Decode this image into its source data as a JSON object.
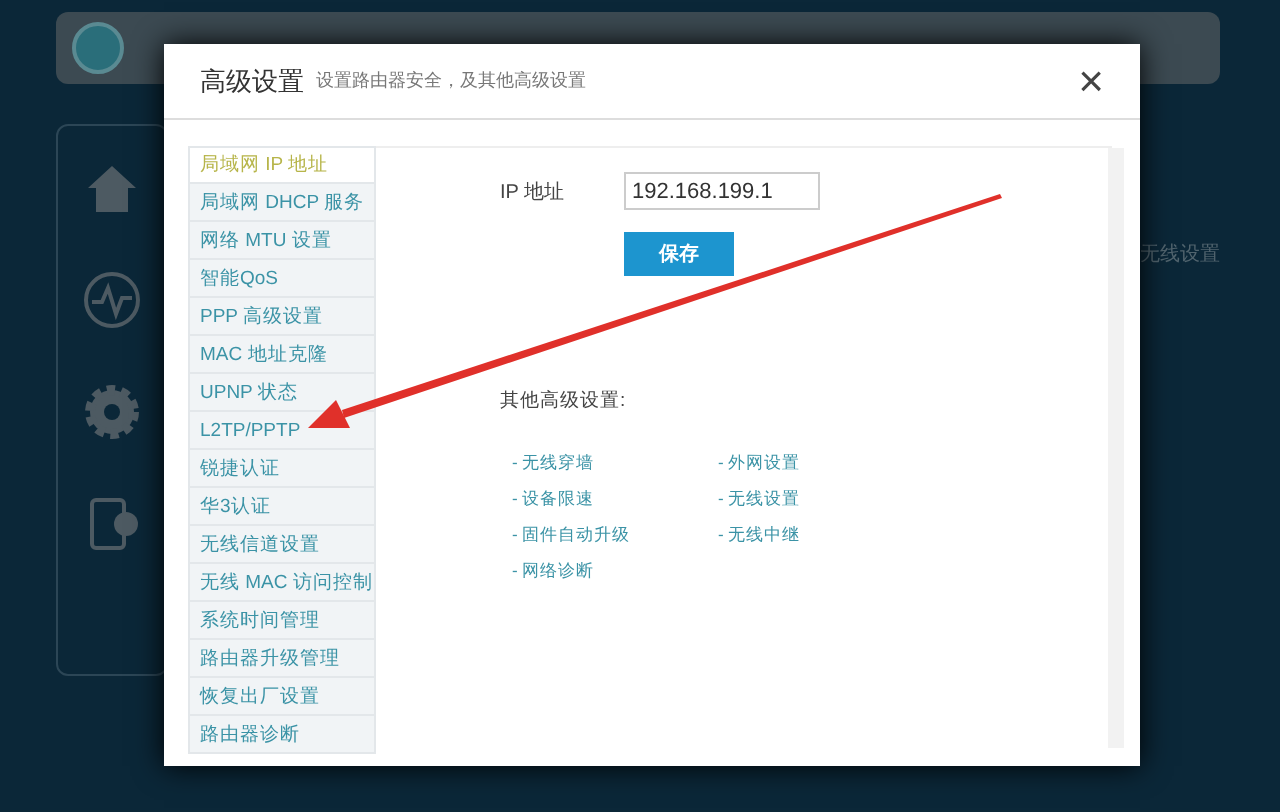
{
  "background": {
    "right_label": "无线设置"
  },
  "dialog": {
    "title": "高级设置",
    "subtitle": "设置路由器安全，及其他高级设置",
    "close": "×"
  },
  "menu": [
    {
      "label": "局域网 IP 地址",
      "selected": true
    },
    {
      "label": "局域网 DHCP 服务",
      "selected": false
    },
    {
      "label": "网络 MTU 设置",
      "selected": false
    },
    {
      "label": "智能QoS",
      "selected": false
    },
    {
      "label": "PPP 高级设置",
      "selected": false
    },
    {
      "label": "MAC 地址克隆",
      "selected": false
    },
    {
      "label": "UPNP 状态",
      "selected": false
    },
    {
      "label": "L2TP/PPTP",
      "selected": false
    },
    {
      "label": "锐捷认证",
      "selected": false
    },
    {
      "label": "华3认证",
      "selected": false
    },
    {
      "label": "无线信道设置",
      "selected": false
    },
    {
      "label": "无线 MAC 访问控制",
      "selected": false
    },
    {
      "label": "系统时间管理",
      "selected": false
    },
    {
      "label": "路由器升级管理",
      "selected": false
    },
    {
      "label": "恢复出厂设置",
      "selected": false
    },
    {
      "label": "路由器诊断",
      "selected": false
    }
  ],
  "form": {
    "ip_label": "IP 地址",
    "ip_value": "192.168.199.1",
    "save": "保存"
  },
  "other": {
    "heading": "其他高级设置:",
    "links": [
      "- 无线穿墙",
      "- 外网设置",
      "- 设备限速",
      "- 无线设置",
      "- 固件自动升级",
      "- 无线中继",
      "- 网络诊断"
    ]
  }
}
